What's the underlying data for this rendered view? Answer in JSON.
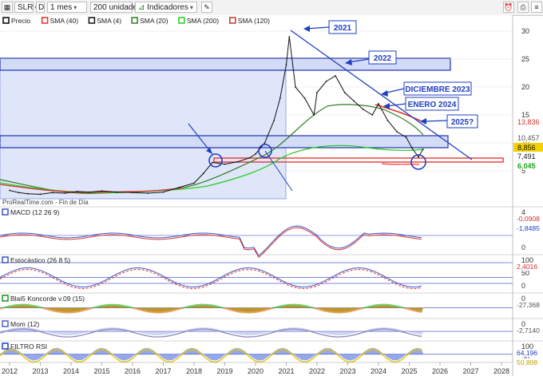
{
  "toolbar": {
    "symbol": "SLR",
    "d_label": "D",
    "period": "1 mes",
    "units": "200 unidades",
    "indicators": "Indicadores"
  },
  "chart_data": [
    {
      "type": "line",
      "legend": [
        "Precio",
        "SMA (40)",
        "SMA (4)",
        "SMA (20)",
        "SMA (200)",
        "SMA (120)"
      ],
      "legend_colors": [
        "#000000",
        "#e0302c",
        "#111111",
        "#2e7d20",
        "#22cc22",
        "#c0392b"
      ],
      "source": "ProRealTime.com - Fin de Día",
      "y_ticks": [
        "30",
        "25",
        "20",
        "15",
        "10",
        "5"
      ],
      "ylim": [
        0,
        32
      ],
      "x_ticks": [
        "2012",
        "2013",
        "2014",
        "2015",
        "2016",
        "2017",
        "2018",
        "2019",
        "2020",
        "2021",
        "2022",
        "2023",
        "2024",
        "2025",
        "2026",
        "2027",
        "2028"
      ],
      "price_badges": [
        {
          "value": "13,836",
          "color": "#d32f2f"
        },
        {
          "value": "10,457",
          "color": "#555555"
        },
        {
          "value": "8,856",
          "color": "#111111",
          "bg": "#f3d200"
        },
        {
          "value": "7,491",
          "color": "#111111"
        },
        {
          "value": "6,045",
          "color": "#1aa31a"
        }
      ],
      "annotations": [
        "2021",
        "2022",
        "DICIEMBRE 2023",
        "ENERO 2024",
        "2025?"
      ],
      "price": {
        "x": [
          2012.0,
          2012.3,
          2012.6,
          2013.0,
          2013.4,
          2013.8,
          2014.2,
          2014.6,
          2015.0,
          2015.5,
          2016.0,
          2016.5,
          2017.0,
          2017.5,
          2018.0,
          2018.3,
          2018.6,
          2019.0,
          2019.4,
          2019.8,
          2020.0,
          2020.3,
          2020.6,
          2020.8,
          2021.0,
          2021.1,
          2021.3,
          2021.6,
          2021.9,
          2022.0,
          2022.3,
          2022.6,
          2022.9,
          2023.2,
          2023.5,
          2023.8,
          2024.0,
          2024.3,
          2024.6,
          2024.9,
          2025.1,
          2025.3,
          2025.45
        ],
        "y": [
          1.5,
          1.1,
          0.9,
          0.8,
          1.1,
          1.0,
          1.3,
          1.2,
          1.4,
          1.2,
          1.1,
          1.0,
          1.2,
          2.0,
          2.8,
          4.5,
          6.5,
          6.2,
          6.6,
          7.3,
          8.0,
          10.0,
          14.0,
          18.0,
          24.0,
          29.0,
          20.0,
          18.0,
          15.0,
          19.0,
          21.0,
          22.0,
          19.0,
          17.5,
          16.0,
          15.0,
          17.0,
          14.0,
          12.0,
          11.0,
          9.0,
          7.5,
          8.856
        ]
      }
    },
    {
      "type": "area",
      "title": "MACD (12 26 9)",
      "y_ticks": [
        "4",
        "2",
        "0"
      ],
      "badges": [
        {
          "value": "-0,0908",
          "color": "#d32f2f"
        },
        {
          "value": "-1,8485",
          "color": "#1f3fbf"
        }
      ]
    },
    {
      "type": "line",
      "title": "Estocástico (26 8 5)",
      "y_ticks": [
        "100",
        "50",
        "0"
      ],
      "badges": [
        {
          "value": "2,4016",
          "color": "#d32f2f"
        }
      ]
    },
    {
      "type": "area",
      "title": "Blai5 Koncorde v.09 (15)",
      "y_ticks": [
        "0"
      ],
      "badges": [
        {
          "value": "-27,368",
          "color": "#555555"
        }
      ]
    },
    {
      "type": "area",
      "title": "Mom (12)",
      "y_ticks": [
        "0"
      ],
      "badges": [
        {
          "value": "-2,7140",
          "color": "#555555"
        }
      ]
    },
    {
      "type": "area",
      "title": "FILTRO RSI",
      "y_ticks": [
        "100",
        "50"
      ],
      "badges": [
        {
          "value": "64,196",
          "color": "#1f3fbf"
        },
        {
          "value": "50,898",
          "color": "#c8a000"
        }
      ]
    }
  ]
}
